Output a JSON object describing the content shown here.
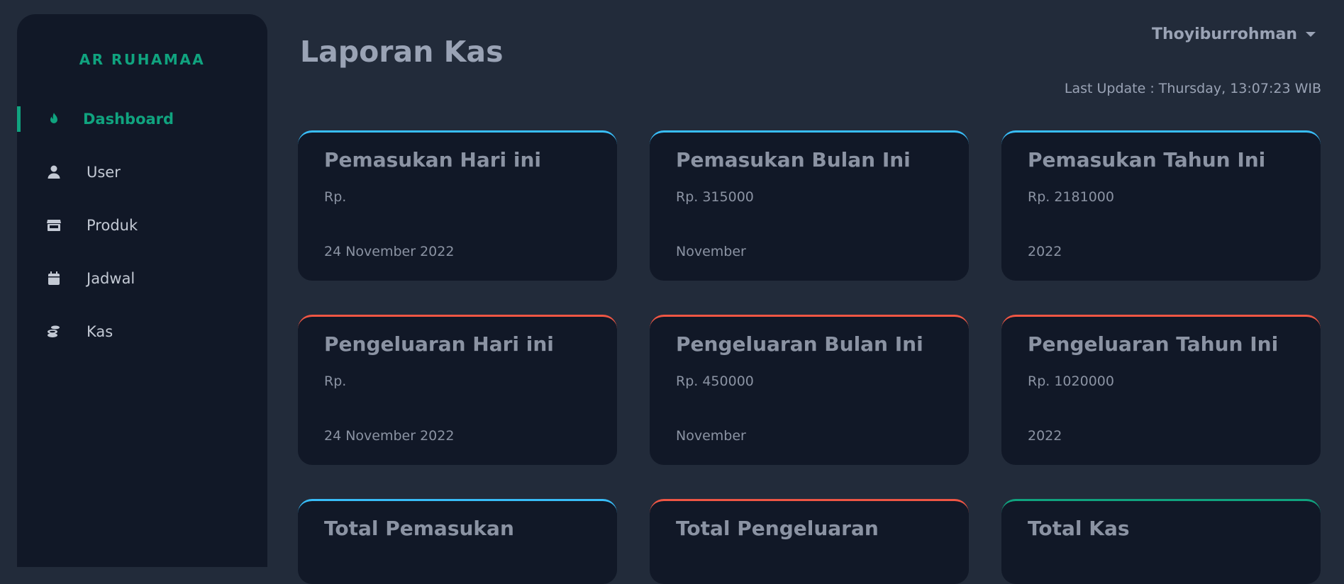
{
  "brand": "AR RUHAMAA",
  "sidebar": {
    "items": [
      {
        "label": "Dashboard",
        "icon": "fire-icon",
        "active": true
      },
      {
        "label": "User",
        "icon": "user-icon",
        "active": false
      },
      {
        "label": "Produk",
        "icon": "store-icon",
        "active": false
      },
      {
        "label": "Jadwal",
        "icon": "calendar-icon",
        "active": false
      },
      {
        "label": "Kas",
        "icon": "coins-icon",
        "active": false
      }
    ]
  },
  "header": {
    "title": "Laporan Kas",
    "user_name": "Thoyiburrohman",
    "last_update": "Last Update : Thursday, 13:07:23 WIB"
  },
  "cards": [
    {
      "title": "Pemasukan Hari ini",
      "value": "Rp.",
      "period": "24 November 2022"
    },
    {
      "title": "Pemasukan Bulan Ini",
      "value": "Rp. 315000",
      "period": "November"
    },
    {
      "title": "Pemasukan Tahun Ini",
      "value": "Rp. 2181000",
      "period": "2022"
    },
    {
      "title": "Pengeluaran Hari ini",
      "value": "Rp.",
      "period": "24 November 2022"
    },
    {
      "title": "Pengeluaran Bulan Ini",
      "value": "Rp. 450000",
      "period": "November"
    },
    {
      "title": "Pengeluaran Tahun Ini",
      "value": "Rp. 1020000",
      "period": "2022"
    },
    {
      "title": "Total Pemasukan"
    },
    {
      "title": "Total Pengeluaran"
    },
    {
      "title": "Total Kas"
    }
  ],
  "colors": {
    "accent": "#10a37f",
    "income": "#38bdf8",
    "expense": "#ef5644",
    "total": "#10a37f"
  }
}
